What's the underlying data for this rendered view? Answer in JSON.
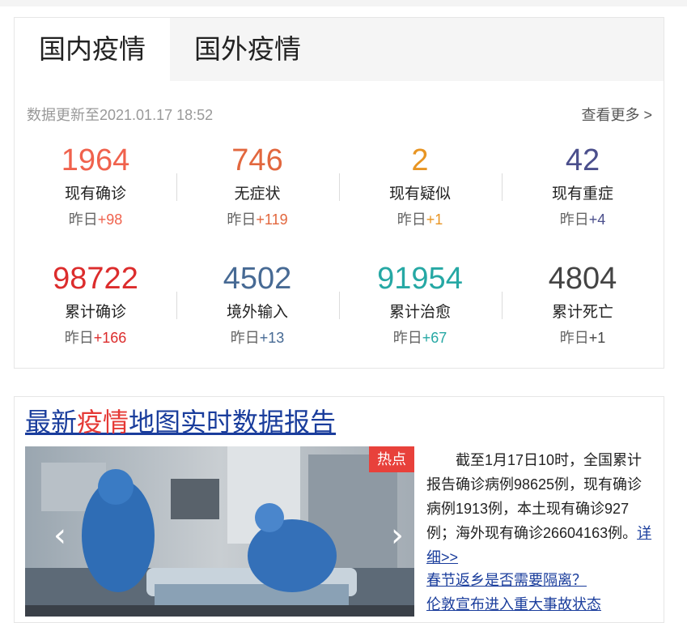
{
  "tabs": [
    {
      "label": "国内疫情",
      "active": true
    },
    {
      "label": "国外疫情",
      "active": false
    }
  ],
  "update_text": "数据更新至2021.01.17 18:52",
  "more_label": "查看更多 >",
  "stats": [
    {
      "value": "1964",
      "label": "现有确诊",
      "prefix": "昨日",
      "delta": "+98",
      "color": "#f0624d"
    },
    {
      "value": "746",
      "label": "无症状",
      "prefix": "昨日",
      "delta": "+119",
      "color": "#e2673e"
    },
    {
      "value": "2",
      "label": "现有疑似",
      "prefix": "昨日",
      "delta": "+1",
      "color": "#e89523"
    },
    {
      "value": "42",
      "label": "现有重症",
      "prefix": "昨日",
      "delta": "+4",
      "color": "#4b4f8c"
    },
    {
      "value": "98722",
      "label": "累计确诊",
      "prefix": "昨日",
      "delta": "+166",
      "color": "#dc2c2c"
    },
    {
      "value": "4502",
      "label": "境外输入",
      "prefix": "昨日",
      "delta": "+13",
      "color": "#476a94"
    },
    {
      "value": "91954",
      "label": "累计治愈",
      "prefix": "昨日",
      "delta": "+67",
      "color": "#26a8a4"
    },
    {
      "value": "4804",
      "label": "累计死亡",
      "prefix": "昨日",
      "delta": "+1",
      "color": "#444444"
    }
  ],
  "news": {
    "headline_part1": "最新",
    "headline_highlight": "疫情",
    "headline_part2": "地图实时数据报告",
    "badge": "热点",
    "story": "截至1月17日10时，全国累计报告确诊病例98625例，现有确诊病例1913例，本土现有确诊927例；海外现有确诊26604163例。",
    "detail_link": "详细>>",
    "links": [
      "春节返乡是否需要隔离？",
      "伦敦宣布进入重大事故状态"
    ]
  },
  "icons": {
    "prev": "chevron-left-icon",
    "next": "chevron-right-icon"
  },
  "colors": {
    "headline_highlight": "#e53935",
    "link": "#1a3d9c",
    "badge": "#e8413b"
  }
}
